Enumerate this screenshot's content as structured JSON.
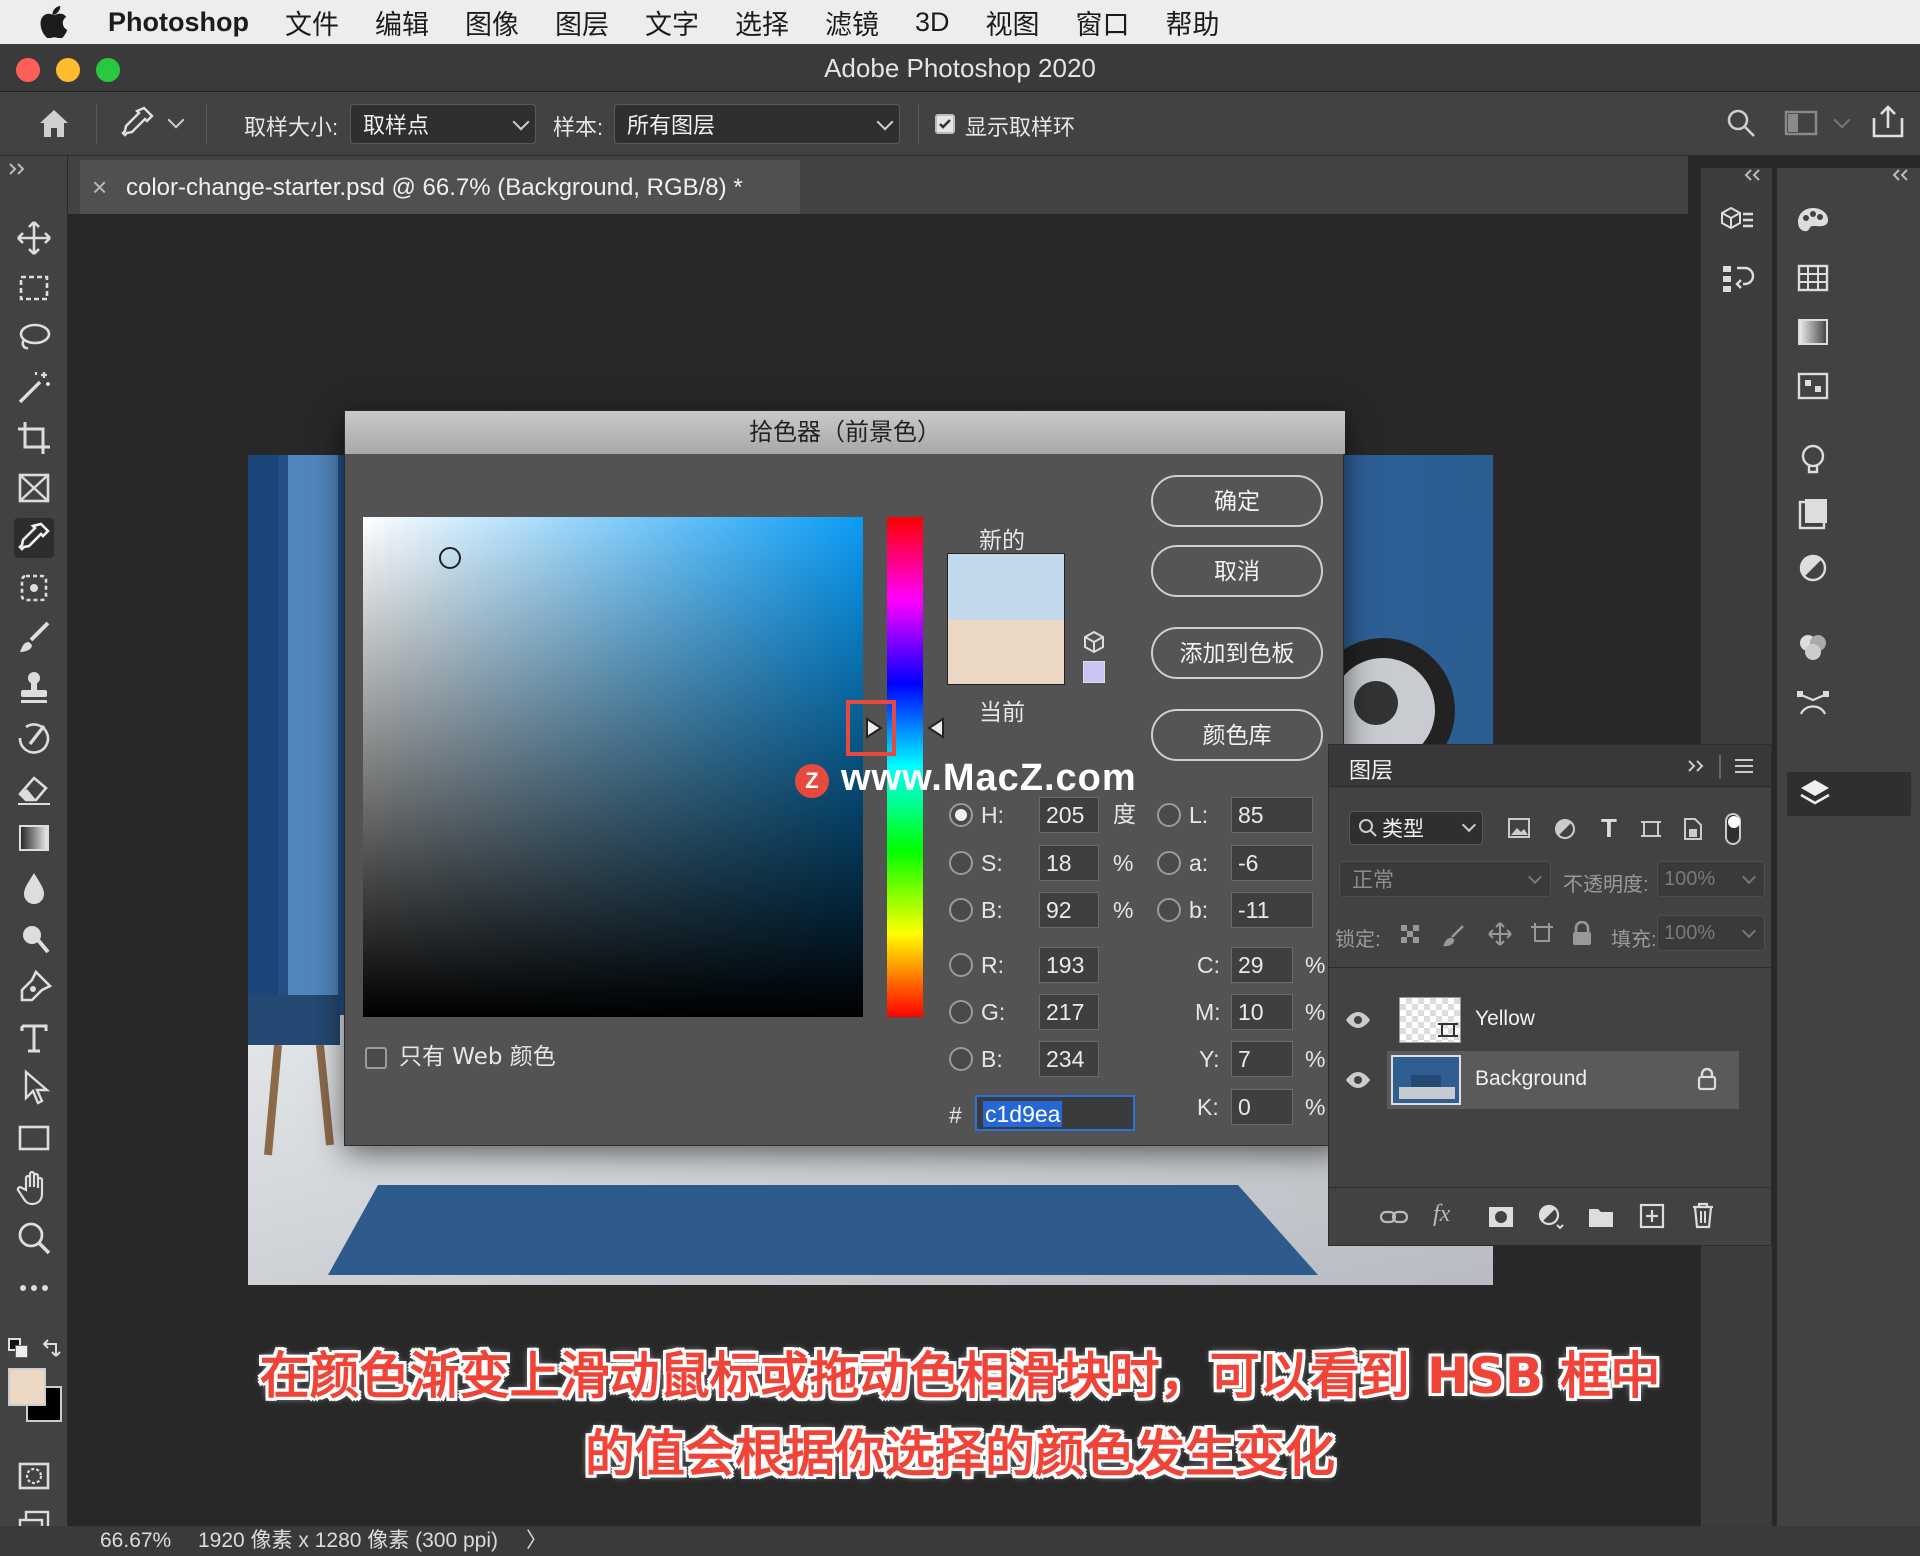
{
  "menubar": {
    "app_name": "Photoshop",
    "items": [
      "文件",
      "编辑",
      "图像",
      "图层",
      "文字",
      "选择",
      "滤镜",
      "3D",
      "视图",
      "窗口",
      "帮助"
    ]
  },
  "window": {
    "title": "Adobe Photoshop 2020"
  },
  "options_bar": {
    "sample_size_label": "取样大小:",
    "sample_size_value": "取样点",
    "sample_label": "样本:",
    "sample_value": "所有图层",
    "show_ring_label": "显示取样环",
    "show_ring_checked": true
  },
  "document_tab": {
    "title": "color-change-starter.psd @ 66.7% (Background, RGB/8) *",
    "close": "×"
  },
  "color_picker": {
    "title": "拾色器（前景色）",
    "buttons": {
      "ok": "确定",
      "cancel": "取消",
      "add_swatch": "添加到色板",
      "libraries": "颜色库"
    },
    "new_label": "新的",
    "current_label": "当前",
    "new_color": "#c1d9ea",
    "current_color": "#ead8c4",
    "hue_base_color": "#0a9cf5",
    "web_only_label": "只有 Web 颜色",
    "fields": {
      "H": {
        "label": "H:",
        "value": "205",
        "unit": "度",
        "selected": true
      },
      "S": {
        "label": "S:",
        "value": "18",
        "unit": "%"
      },
      "Bv": {
        "label": "B:",
        "value": "92",
        "unit": "%"
      },
      "R": {
        "label": "R:",
        "value": "193"
      },
      "G": {
        "label": "G:",
        "value": "217"
      },
      "Bl": {
        "label": "B:",
        "value": "234"
      },
      "L": {
        "label": "L:",
        "value": "85"
      },
      "a": {
        "label": "a:",
        "value": "-6"
      },
      "b": {
        "label": "b:",
        "value": "-11"
      },
      "C": {
        "label": "C:",
        "value": "29",
        "unit": "%"
      },
      "M": {
        "label": "M:",
        "value": "10",
        "unit": "%"
      },
      "Y": {
        "label": "Y:",
        "value": "7",
        "unit": "%"
      },
      "K": {
        "label": "K:",
        "value": "0",
        "unit": "%"
      }
    },
    "hex_label": "#",
    "hex_value": "c1d9ea"
  },
  "watermark": {
    "text": "www.MacZ.com",
    "badge": "Z"
  },
  "layers_panel": {
    "title": "图层",
    "filter_label": "类型",
    "blend_mode": "正常",
    "opacity_label": "不透明度:",
    "opacity_value": "100%",
    "lock_label": "锁定:",
    "fill_label": "填充:",
    "fill_value": "100%",
    "layers": [
      {
        "name": "Yellow",
        "visible": true
      },
      {
        "name": "Background",
        "visible": true,
        "locked": true
      }
    ]
  },
  "status_bar": {
    "zoom": "66.67%",
    "info": "1920 像素 x 1280 像素 (300 ppi)",
    "arrow": "〉"
  },
  "caption": {
    "line1": "在颜色渐变上滑动鼠标或拖动色相滑块时，可以看到 HSB 框中",
    "line2": "的值会根据你选择的颜色发生变化"
  },
  "colors": {
    "foreground": "#ead8c4",
    "background": "#000000",
    "highlight": "#e8493e",
    "selection": "#2567d4"
  }
}
